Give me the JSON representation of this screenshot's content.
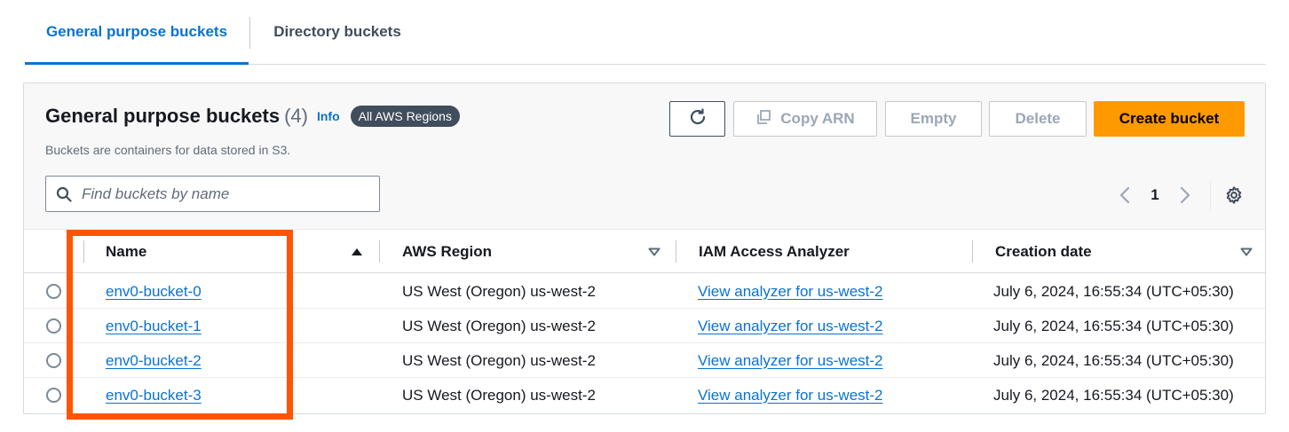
{
  "tabs": [
    {
      "label": "General purpose buckets",
      "active": true
    },
    {
      "label": "Directory buckets",
      "active": false
    }
  ],
  "panel": {
    "title": "General purpose buckets",
    "count": "(4)",
    "info": "Info",
    "region_badge": "All AWS Regions",
    "subtitle": "Buckets are containers for data stored in S3."
  },
  "actions": {
    "refresh_icon": "refresh-icon",
    "copy_arn": "Copy ARN",
    "empty": "Empty",
    "delete": "Delete",
    "create": "Create bucket"
  },
  "search": {
    "placeholder": "Find buckets by name",
    "value": ""
  },
  "pagination": {
    "current_page": "1"
  },
  "table": {
    "columns": [
      "Name",
      "AWS Region",
      "IAM Access Analyzer",
      "Creation date"
    ],
    "sort": {
      "column": "Name",
      "direction": "ascending"
    },
    "rows": [
      {
        "name": "env0-bucket-0",
        "region": "US West (Oregon) us-west-2",
        "analyzer": "View analyzer for us-west-2",
        "created": "July 6, 2024, 16:55:34 (UTC+05:30)"
      },
      {
        "name": "env0-bucket-1",
        "region": "US West (Oregon) us-west-2",
        "analyzer": "View analyzer for us-west-2",
        "created": "July 6, 2024, 16:55:34 (UTC+05:30)"
      },
      {
        "name": "env0-bucket-2",
        "region": "US West (Oregon) us-west-2",
        "analyzer": "View analyzer for us-west-2",
        "created": "July 6, 2024, 16:55:34 (UTC+05:30)"
      },
      {
        "name": "env0-bucket-3",
        "region": "US West (Oregon) us-west-2",
        "analyzer": "View analyzer for us-west-2",
        "created": "July 6, 2024, 16:55:34 (UTC+05:30)"
      }
    ]
  },
  "colors": {
    "accent": "#0972d3",
    "primary_button": "#ff9900",
    "highlight_box": "#ff5500",
    "badge_bg": "#414d5c"
  }
}
